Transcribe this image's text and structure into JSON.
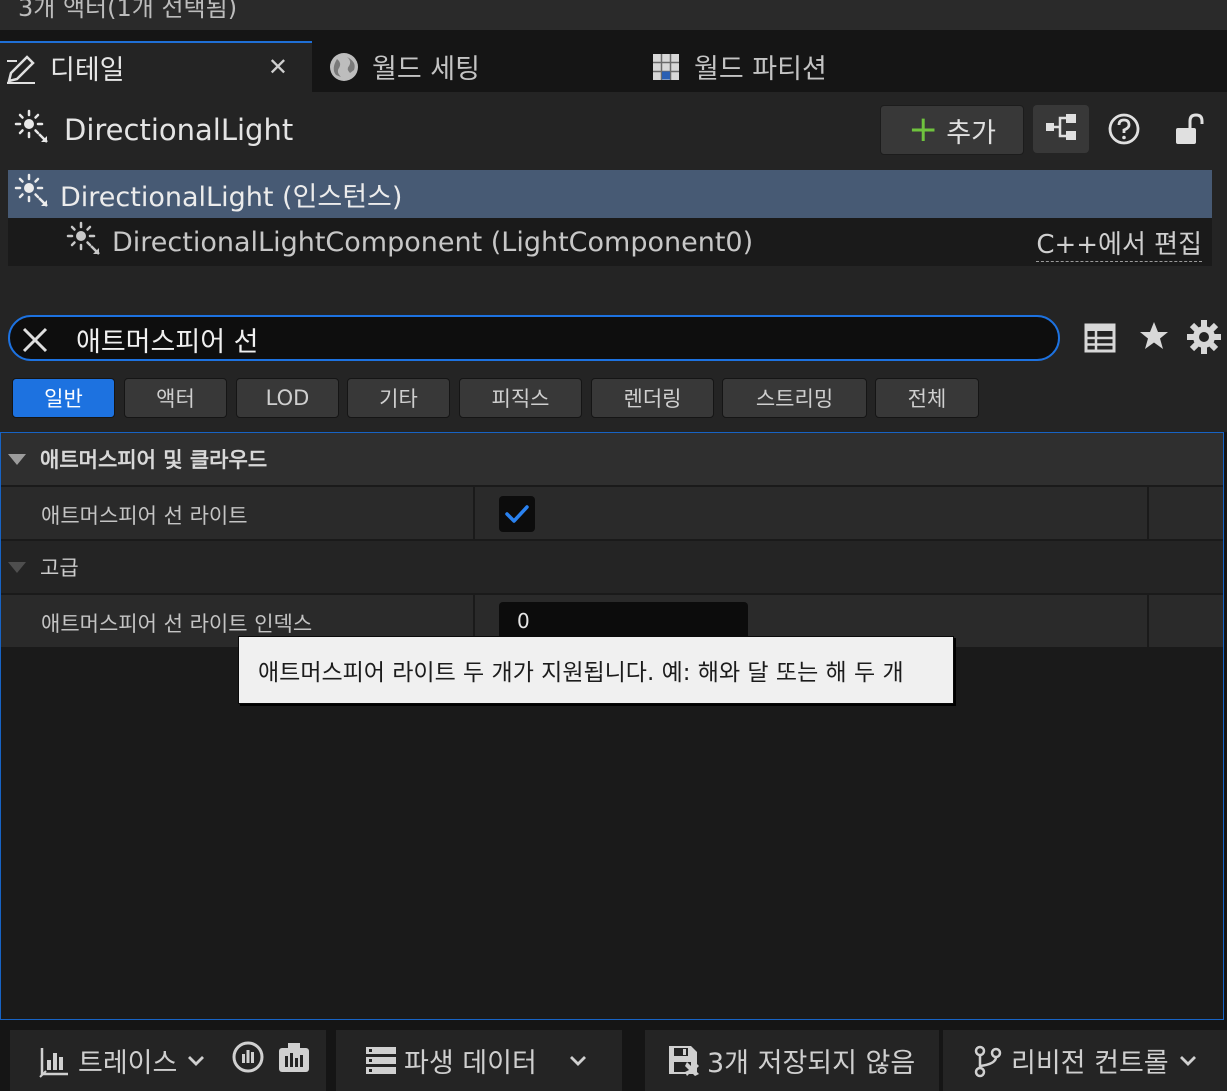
{
  "window": {
    "top_strip_text": "3개 액터(1개 선택됨)"
  },
  "tabs": [
    {
      "label": "디테일",
      "icon": "pencil-icon",
      "active": true,
      "close": "✕"
    },
    {
      "label": "월드 세팅",
      "icon": "globe-icon"
    },
    {
      "label": "월드 파티션",
      "icon": "grid-map-icon"
    }
  ],
  "details": {
    "object_name": "DirectionalLight",
    "add_label": "추가",
    "components": {
      "root_label": "DirectionalLight (인스턴스)",
      "child_label": "DirectionalLightComponent (LightComponent0)",
      "edit_cpp_label": "C++에서 편집"
    }
  },
  "search": {
    "value": "애트머스피어 선"
  },
  "filters": [
    "일반",
    "액터",
    "LOD",
    "기타",
    "피직스",
    "렌더링",
    "스트리밍",
    "전체"
  ],
  "active_filter": "일반",
  "properties": {
    "category_label": "애트머스피어 및 클라우드",
    "sun_light_label": "애트머스피어 선 라이트",
    "sun_light_checked": true,
    "advanced_label": "고급",
    "sun_light_index_label": "애트머스피어 선 라이트 인덱스",
    "sun_light_index_value": "0"
  },
  "tooltip": "애트머스피어 라이트 두 개가 지원됩니다. 예: 해와 달 또는 해 두 개",
  "statusbar": {
    "trace_label": "트레이스",
    "derived_data_label": "파생 데이터",
    "unsaved_label": "3개 저장되지 않음",
    "revision_control_label": "리비전 컨트롤"
  },
  "colors": {
    "accent": "#1d72e0",
    "selection_row": "#475a74",
    "add_plus": "#6fc33e"
  }
}
